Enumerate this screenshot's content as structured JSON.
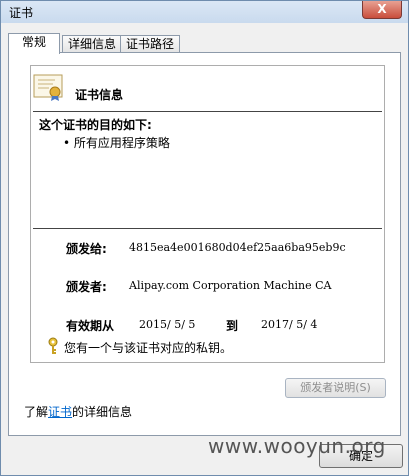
{
  "window": {
    "title": "证书",
    "close_label": "X"
  },
  "tabs": [
    {
      "label": "常规"
    },
    {
      "label": "详细信息"
    },
    {
      "label": "证书路径"
    }
  ],
  "cert": {
    "heading": "证书信息",
    "purpose_title": "这个证书的目的如下:",
    "purpose_item": "• 所有应用程序策略",
    "issued_to_label": "颁发给:",
    "issued_to_value": "4815ea4e001680d04ef25aa6ba95eb9c",
    "issued_by_label": "颁发者:",
    "issued_by_value": "Alipay.com Corporation Machine CA",
    "validity_label": "有效期从",
    "valid_from": "2015/ 5/ 5",
    "to_label": "到",
    "valid_to": "2017/ 5/ 4",
    "private_key_note": "您有一个与该证书对应的私钥。"
  },
  "buttons": {
    "issuer_statement": "颁发者说明(S)",
    "ok": "确定"
  },
  "footer": {
    "learn_prefix": "了解",
    "learn_link": "证书",
    "learn_suffix": "的详细信息"
  },
  "watermark": "www.wooyun.org",
  "icons": {
    "certificate": "certificate-icon",
    "key": "key-icon",
    "close": "close-icon"
  }
}
